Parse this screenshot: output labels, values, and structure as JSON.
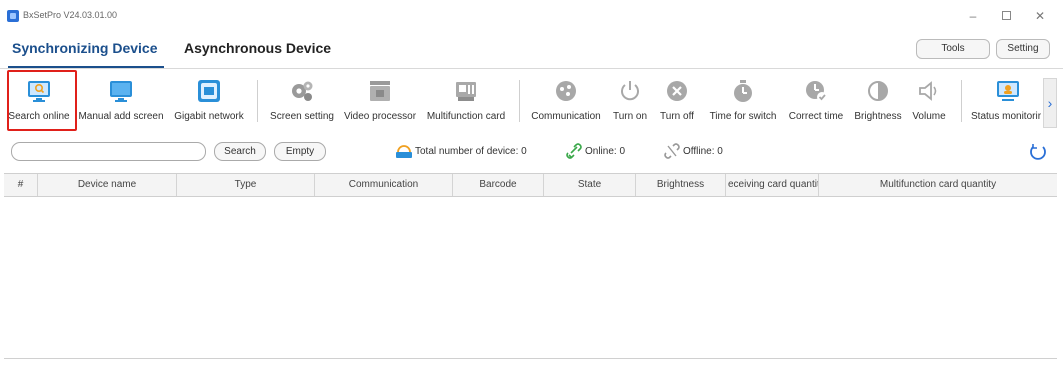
{
  "window": {
    "title": "BxSetPro V24.03.01.00",
    "min": "–",
    "close": "✕"
  },
  "tabs": {
    "sync": "Synchronizing Device",
    "async": "Asynchronous Device"
  },
  "top_buttons": {
    "tools": "Tools",
    "setting": "Setting"
  },
  "toolbar": {
    "items": [
      {
        "label": "Search online",
        "icon": "monitor-search-icon"
      },
      {
        "label": "Manual add screen",
        "icon": "monitor-icon"
      },
      {
        "label": "Gigabit network",
        "icon": "network-card-icon"
      },
      {
        "label": "Screen setting",
        "icon": "gears-icon"
      },
      {
        "label": "Video processor",
        "icon": "video-processor-icon"
      },
      {
        "label": "Multifunction card",
        "icon": "multifunction-card-icon"
      },
      {
        "label": "Communication",
        "icon": "communication-icon"
      },
      {
        "label": "Turn on",
        "icon": "power-on-icon"
      },
      {
        "label": "Turn off",
        "icon": "power-off-icon"
      },
      {
        "label": "Time for switch",
        "icon": "timer-icon"
      },
      {
        "label": "Correct time",
        "icon": "clock-check-icon"
      },
      {
        "label": "Brightness",
        "icon": "brightness-icon"
      },
      {
        "label": "Volume",
        "icon": "volume-icon"
      },
      {
        "label": "Status monitorir",
        "icon": "status-monitor-icon"
      }
    ],
    "scroll_right": "›"
  },
  "search": {
    "placeholder": "",
    "search_label": "Search",
    "empty_label": "Empty"
  },
  "stats": {
    "total": "Total number of device: 0",
    "online": "Online: 0",
    "offline": "Offline: 0"
  },
  "table": {
    "columns": [
      "#",
      "Device name",
      "Type",
      "Communication",
      "Barcode",
      "State",
      "Brightness",
      "eceiving card quantit",
      "Multifunction card quantity"
    ],
    "rows": []
  },
  "colors": {
    "accent": "#1b4f8c",
    "highlight": "#e0201a",
    "icon_blue": "#2a8fd8",
    "icon_gray": "#9a9a9a"
  }
}
